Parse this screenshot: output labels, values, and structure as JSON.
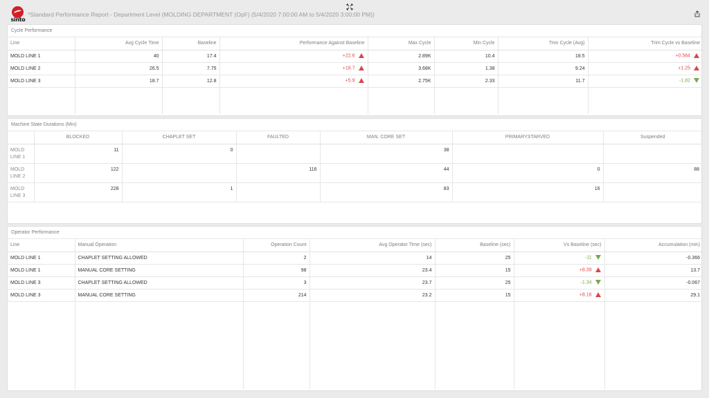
{
  "header": {
    "logo_text": "sinto",
    "report_title": "*Standard Performance Report - Department Level (MOLDING DEPARTMENT (OpF) (5/4/2020 7:00:00 AM to 5/4/2020 3:00:00 PM))"
  },
  "cycle": {
    "title": "Cycle Performance",
    "columns": [
      "Line",
      "Avg Cycle Time",
      "Baseline",
      "Performance Against Baseline",
      "Max Cycle",
      "Min Cycle",
      "Trim Cycle (Avg)",
      "Trim Cycle vs Baseline"
    ],
    "rows": [
      {
        "line": "MOLD LINE 1",
        "avg": "40",
        "baseline": "17.4",
        "perf": "+22.6",
        "max": "2.89K",
        "min": "10.4",
        "trim": "18.5",
        "trimvs": "+0.564"
      },
      {
        "line": "MOLD LINE 2",
        "avg": "26.5",
        "baseline": "7.75",
        "perf": "+18.7",
        "max": "3.68K",
        "min": "1.38",
        "trim": "9.24",
        "trimvs": "+1.25"
      },
      {
        "line": "MOLD LINE 3",
        "avg": "18.7",
        "baseline": "12.8",
        "perf": "+5.9",
        "max": "2.75K",
        "min": "2.33",
        "trim": "11.7",
        "trimvs": "-1.82"
      }
    ]
  },
  "machine": {
    "title": "Machine State Durations (Min)",
    "columns": [
      "",
      "BLOCKED",
      "CHAPLET SET",
      "FAULTED",
      "MAN. CORE SET",
      "PRIMARYSTARVED",
      "Suspended"
    ],
    "rows": [
      {
        "line": "MOLD LINE 1",
        "blocked": "11",
        "chaplet": "0",
        "faulted": "",
        "core": "38",
        "starved": "",
        "suspended": ""
      },
      {
        "line": "MOLD LINE 2",
        "blocked": "122",
        "chaplet": "",
        "faulted": "116",
        "core": "44",
        "starved": "0",
        "suspended": "88"
      },
      {
        "line": "MOLD LINE 3",
        "blocked": "228",
        "chaplet": "1",
        "faulted": "",
        "core": "83",
        "starved": "16",
        "suspended": ""
      }
    ]
  },
  "operator": {
    "title": "Operator Performance",
    "columns": [
      "Line",
      "Manual Operation",
      "Operation Count",
      "Avg Operator Time (sec)",
      "Baseline (sec)",
      "Vs Baseline (sec)",
      "Accumulation (min)"
    ],
    "rows": [
      {
        "line": "MOLD LINE 1",
        "op": "CHAPLET SETTING ALLOWED",
        "count": "2",
        "avg": "14",
        "baseline": "25",
        "vs": "-11",
        "acc": "-0.366"
      },
      {
        "line": "MOLD LINE 1",
        "op": "MANUAL CORE SETTING",
        "count": "98",
        "avg": "23.4",
        "baseline": "15",
        "vs": "+8.39",
        "acc": "13.7"
      },
      {
        "line": "MOLD LINE 3",
        "op": "CHAPLET SETTING ALLOWED",
        "count": "3",
        "avg": "23.7",
        "baseline": "25",
        "vs": "-1.34",
        "acc": "-0.067"
      },
      {
        "line": "MOLD LINE 3",
        "op": "MANUAL CORE SETTING",
        "count": "214",
        "avg": "23.2",
        "baseline": "15",
        "vs": "+8.16",
        "acc": "29.1"
      }
    ]
  },
  "icons": {
    "fullscreen": "fullscreen-icon",
    "export": "export-icon",
    "up": "triangle-up-icon",
    "down": "triangle-down-icon"
  },
  "colors": {
    "brand": "#d21f26",
    "positive_bad": "#e0474c",
    "negative_good": "#74a94a"
  }
}
